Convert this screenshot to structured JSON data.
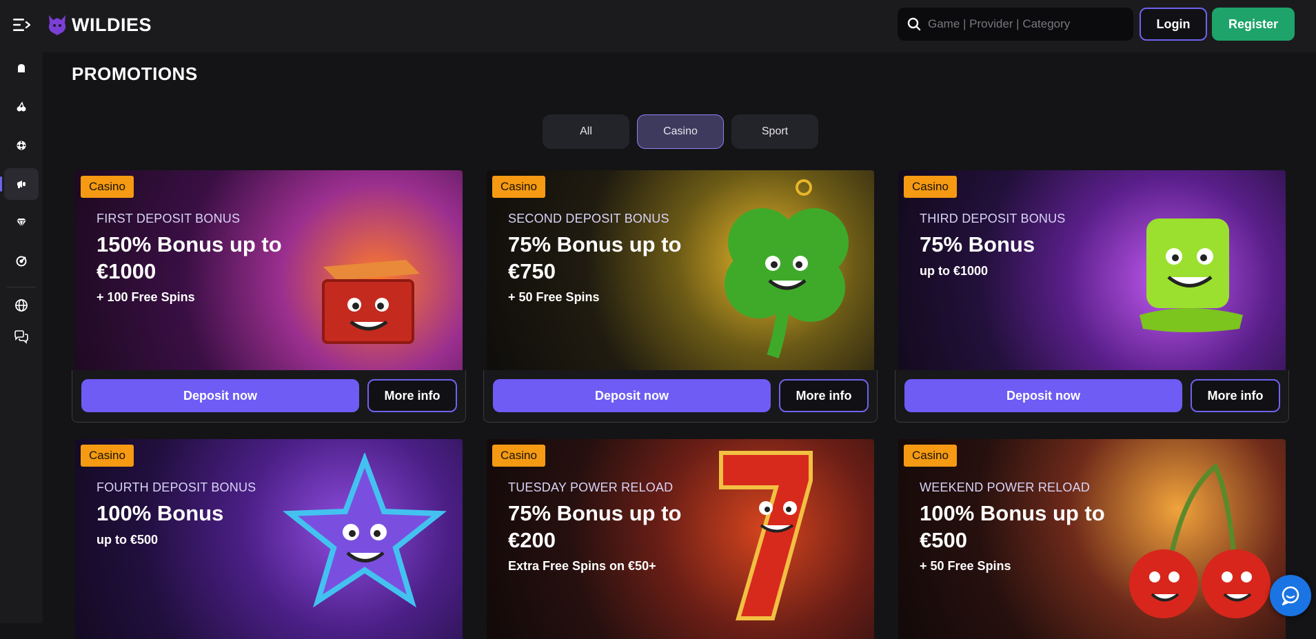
{
  "header": {
    "logo_text": "WILDIES",
    "search_placeholder": "Game | Provider | Category",
    "login_label": "Login",
    "register_label": "Register"
  },
  "sidebar": {
    "items": [
      {
        "icon": "slots-icon"
      },
      {
        "icon": "cherries-icon"
      },
      {
        "icon": "roulette-icon"
      },
      {
        "icon": "promotions-megaphone-icon",
        "active": true
      },
      {
        "icon": "vip-diamond-icon"
      },
      {
        "icon": "target-icon"
      },
      {
        "icon": "globe-icon"
      },
      {
        "icon": "chat-icon"
      }
    ]
  },
  "page": {
    "title": "PROMOTIONS",
    "filters": [
      {
        "label": "All",
        "active": false
      },
      {
        "label": "Casino",
        "active": true
      },
      {
        "label": "Sport",
        "active": false
      }
    ]
  },
  "promotions": [
    {
      "badge": "Casino",
      "subtitle": "FIRST DEPOSIT BONUS",
      "title": "150% Bonus up to €1000",
      "extra": "+ 100 Free Spins",
      "deposit_label": "Deposit now",
      "more_label": "More info"
    },
    {
      "badge": "Casino",
      "subtitle": "SECOND DEPOSIT BONUS",
      "title": "75% Bonus up to €750",
      "extra": "+ 50 Free Spins",
      "deposit_label": "Deposit now",
      "more_label": "More info"
    },
    {
      "badge": "Casino",
      "subtitle": "THIRD DEPOSIT BONUS",
      "title": "75% Bonus",
      "extra": "up to €1000",
      "deposit_label": "Deposit now",
      "more_label": "More info"
    },
    {
      "badge": "Casino",
      "subtitle": "FOURTH DEPOSIT BONUS",
      "title": "100% Bonus",
      "extra": "up to €500"
    },
    {
      "badge": "Casino",
      "subtitle": "TUESDAY POWER RELOAD",
      "title": "75% Bonus up to €200",
      "extra": "Extra Free Spins on €50+"
    },
    {
      "badge": "Casino",
      "subtitle": "WEEKEND POWER RELOAD",
      "title": "100% Bonus up to €500",
      "extra": "+ 50 Free Spins"
    }
  ],
  "colors": {
    "accent": "#6e5cf5",
    "register": "#1ea46a",
    "badge": "#f59a12",
    "background": "#141416"
  }
}
